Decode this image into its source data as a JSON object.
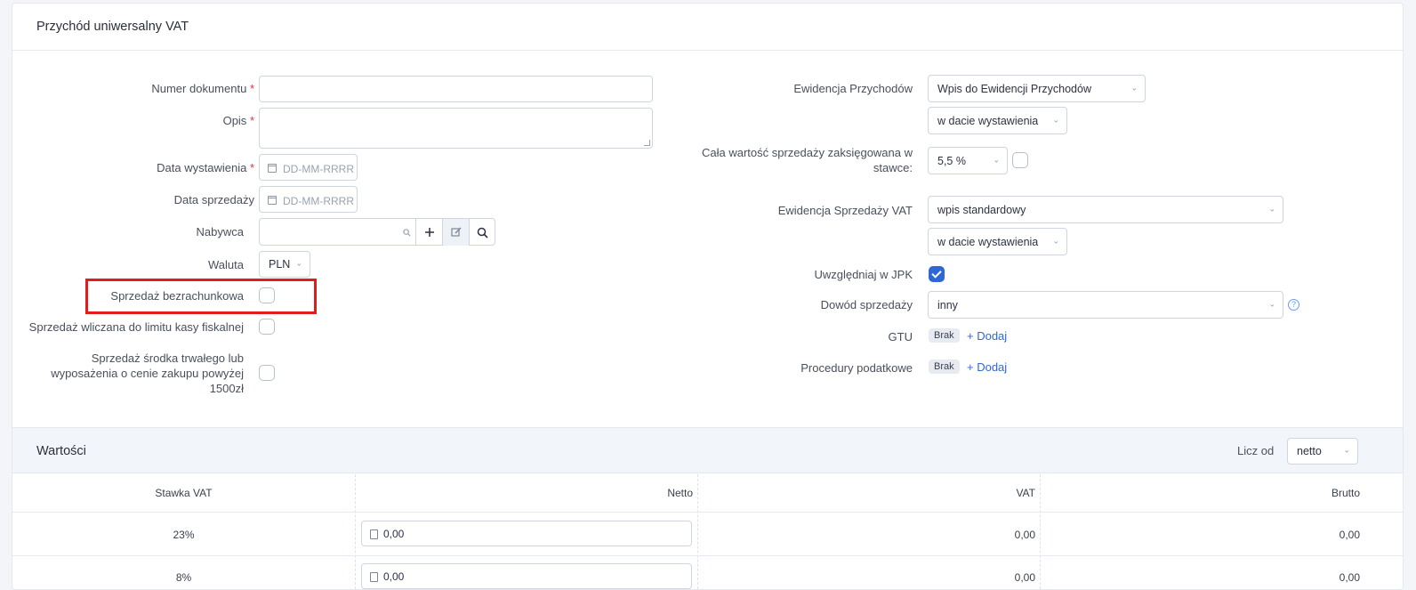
{
  "header": {
    "title": "Przychód uniwersalny VAT"
  },
  "left": {
    "numer_label": "Numer dokumentu",
    "opis_label": "Opis",
    "data_wyst_label": "Data wystawienia",
    "data_sprz_label": "Data sprzedaży",
    "date_placeholder": "DD-MM-RRRR",
    "nabywca_label": "Nabywca",
    "waluta_label": "Waluta",
    "waluta_value": "PLN",
    "bezrach_label": "Sprzedaż bezrachunkowa",
    "limit_kasy_label": "Sprzedaż wliczana do limitu kasy fiskalnej",
    "srodek_label_1": "Sprzedaż środka trwałego lub",
    "srodek_label_2": "wyposażenia o cenie zakupu powyżej",
    "srodek_label_3": "1500zł",
    "required_mark": "*"
  },
  "right": {
    "ewid_przych_label": "Ewidencja Przychodów",
    "ewid_przych_value": "Wpis do Ewidencji Przychodów",
    "w_dacie_1": "w dacie wystawienia",
    "cala_label_1": "Cała wartość sprzedaży zaksięgowana w",
    "cala_label_2": "stawce:",
    "stawka_value": "5,5 %",
    "ewid_vat_label": "Ewidencja Sprzedaży VAT",
    "ewid_vat_value": "wpis standardowy",
    "w_dacie_2": "w dacie wystawienia",
    "jpk_label": "Uwzględniaj w JPK",
    "dowod_label": "Dowód sprzedaży",
    "dowod_value": "inny",
    "gtu_label": "GTU",
    "gtu_badge": "Brak",
    "dodaj": "+ Dodaj",
    "proc_label": "Procedury podatkowe",
    "proc_badge": "Brak"
  },
  "values": {
    "title": "Wartości",
    "licz_od_label": "Licz od",
    "licz_od_value": "netto",
    "columns": [
      "Stawka VAT",
      "Netto",
      "VAT",
      "Brutto"
    ],
    "rows": [
      {
        "stawka": "23%",
        "netto": "0,00",
        "vat": "0,00",
        "brutto": "0,00"
      },
      {
        "stawka": "8%",
        "netto": "0,00",
        "vat": "0,00",
        "brutto": "0,00"
      }
    ]
  }
}
